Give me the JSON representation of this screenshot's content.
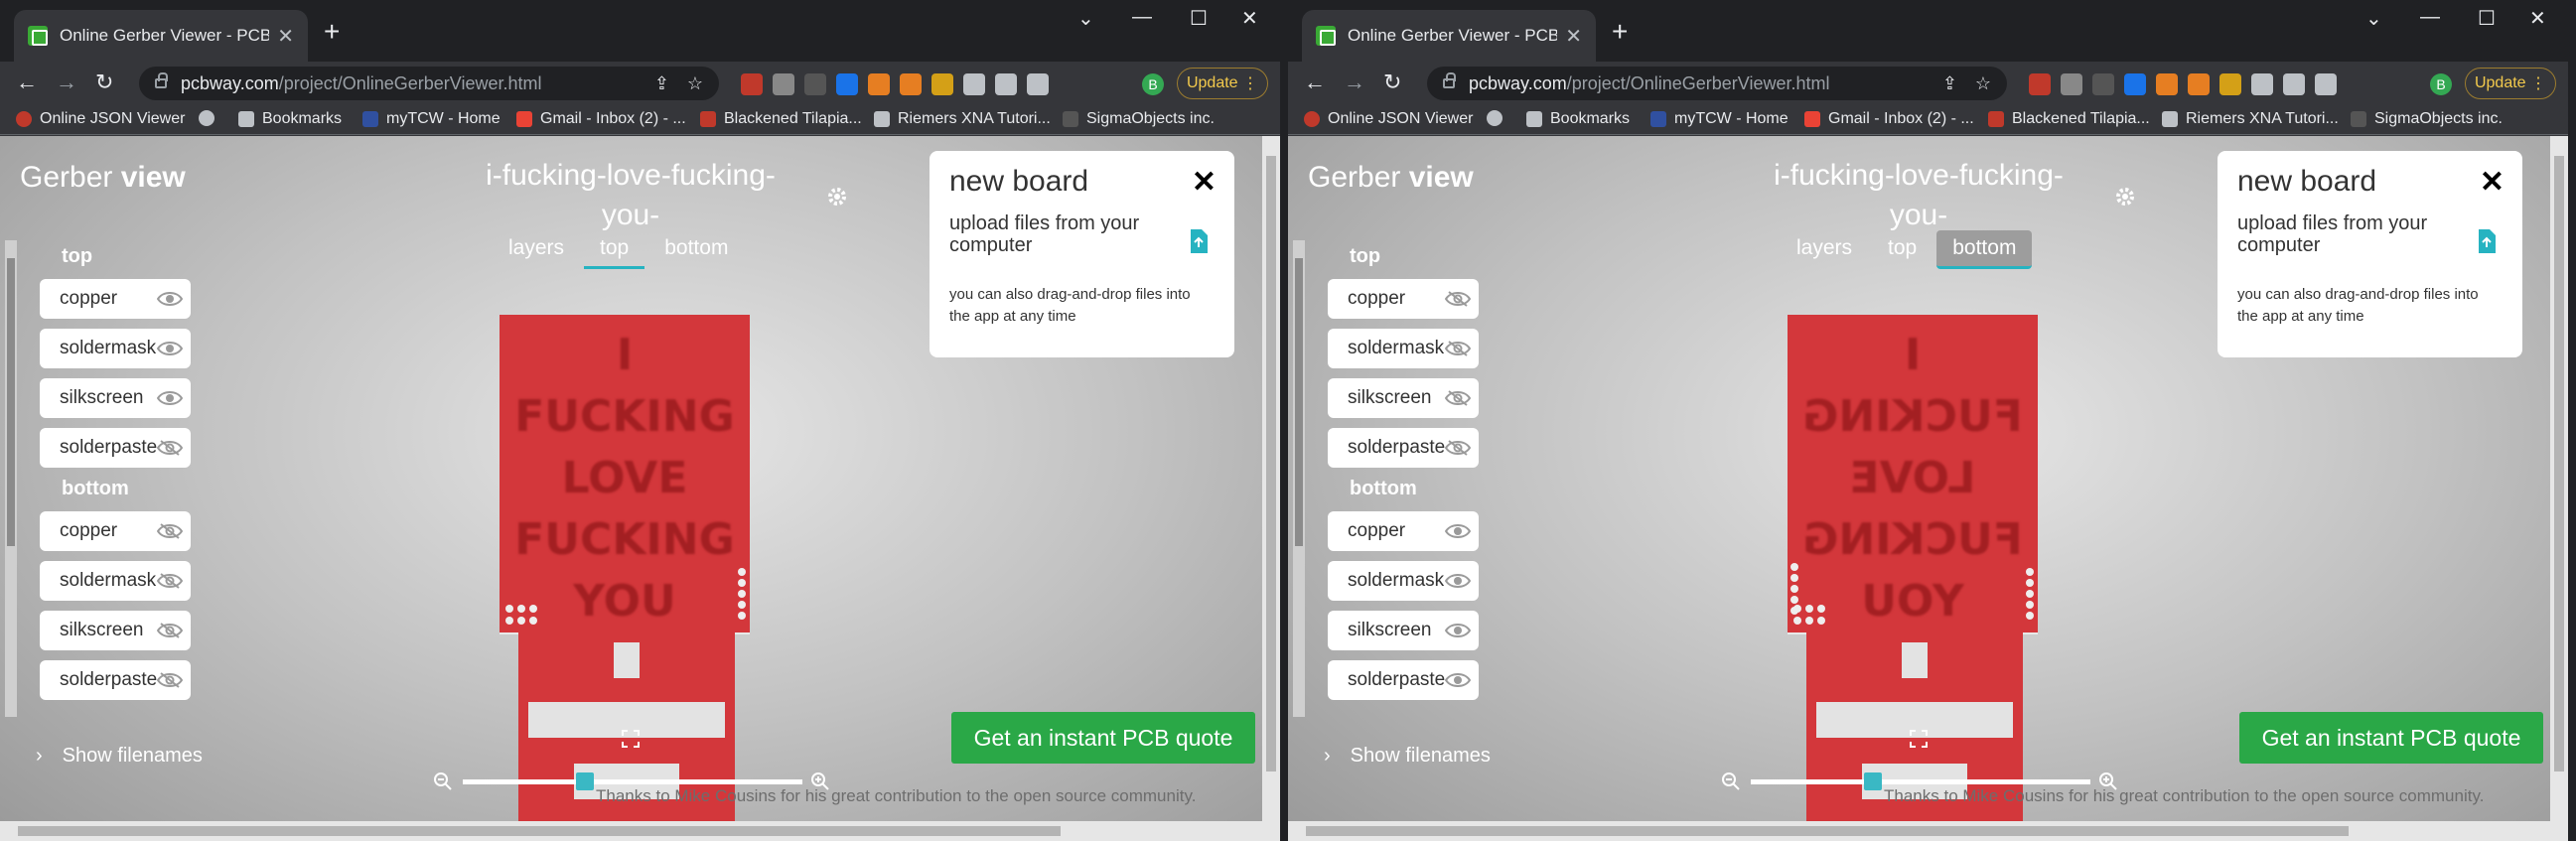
{
  "browser": {
    "tab_title": "Online Gerber Viewer - PCB Proto",
    "url_host": "pcbway.com",
    "url_path": "/project/OnlineGerberViewer.html",
    "update_label": "Update",
    "profile_initial": "B",
    "bookmarks": [
      "Online JSON Viewer",
      "Bookmarks",
      "myTCW - Home",
      "Gmail - Inbox (2) - ...",
      "Blackened Tilapia...",
      "Riemers XNA Tutori...",
      "SigmaObjects inc."
    ]
  },
  "app": {
    "logo_main": "Gerber ",
    "logo_accent": "view",
    "board_name": "i-fucking-love-fucking-you-",
    "tabs": [
      "layers",
      "top",
      "bottom"
    ],
    "top_group": "top",
    "bottom_group": "bottom",
    "layers": [
      "copper",
      "soldermask",
      "silkscreen",
      "solderpaste"
    ],
    "show_filenames": "Show filenames",
    "board_text_lines": [
      "I",
      "FUCKING",
      "LOVE",
      "FUCKING",
      "YOU"
    ],
    "credit": "Thanks to Mike Cousins for his great contribution to the open source community.",
    "new_board": {
      "title": "new board",
      "upload_text": "upload files from your computer",
      "drag_text": "you can also drag-and-drop files into the app at any time"
    },
    "quote_button": "Get an instant PCB quote"
  },
  "views": [
    {
      "active_tab": "top",
      "eyes_top": [
        true,
        true,
        true,
        false
      ],
      "eyes_bottom": [
        false,
        false,
        false,
        false
      ]
    },
    {
      "active_tab": "bottom",
      "eyes_top": [
        false,
        false,
        false,
        false
      ],
      "eyes_bottom": [
        true,
        true,
        true,
        true
      ]
    }
  ]
}
